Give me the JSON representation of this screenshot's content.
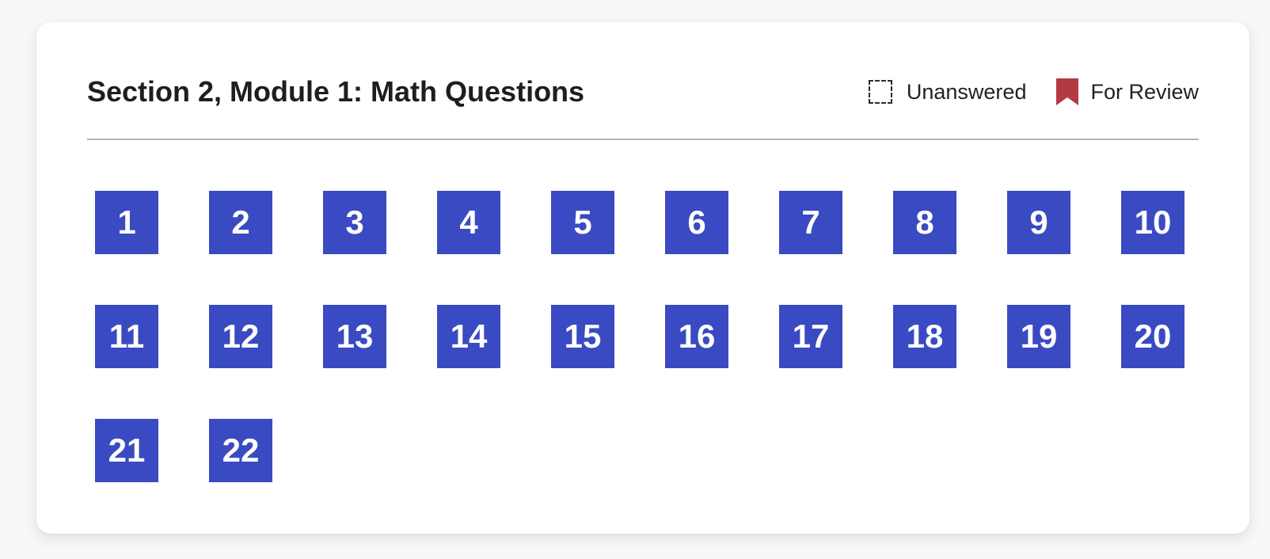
{
  "header": {
    "title": "Section 2, Module 1: Math Questions"
  },
  "legend": {
    "unanswered": {
      "icon": "dashed-square-icon",
      "label": "Unanswered"
    },
    "for_review": {
      "icon": "bookmark-icon",
      "label": "For Review",
      "color": "#b33a45"
    }
  },
  "colors": {
    "answered": "#3a4ac2",
    "review": "#b33a45"
  },
  "questions": [
    {
      "number": "1"
    },
    {
      "number": "2"
    },
    {
      "number": "3"
    },
    {
      "number": "4"
    },
    {
      "number": "5"
    },
    {
      "number": "6"
    },
    {
      "number": "7"
    },
    {
      "number": "8"
    },
    {
      "number": "9"
    },
    {
      "number": "10"
    },
    {
      "number": "11"
    },
    {
      "number": "12"
    },
    {
      "number": "13"
    },
    {
      "number": "14"
    },
    {
      "number": "15"
    },
    {
      "number": "16"
    },
    {
      "number": "17"
    },
    {
      "number": "18"
    },
    {
      "number": "19"
    },
    {
      "number": "20"
    },
    {
      "number": "21"
    },
    {
      "number": "22"
    }
  ]
}
